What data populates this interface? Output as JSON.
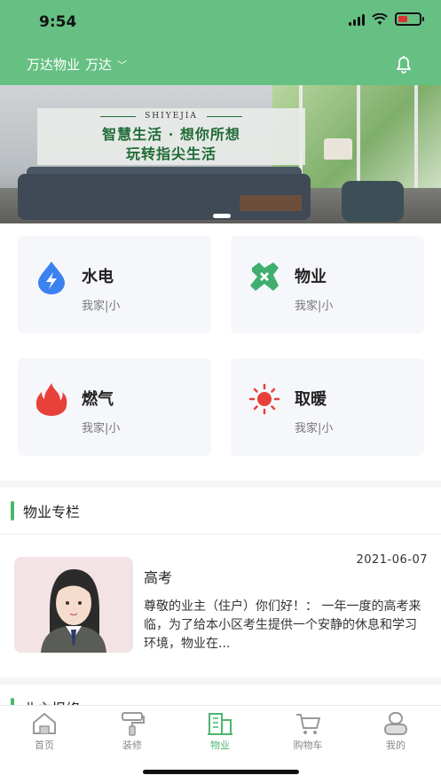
{
  "status_bar": {
    "time": "9:54"
  },
  "header": {
    "title": "万达物业",
    "community": "万达",
    "community_chevron": "﹀"
  },
  "banner": {
    "brand": "SHIYEJIA",
    "slogan_line1": "智慧生活 · 想你所想",
    "slogan_line2": "玩转指尖生活"
  },
  "services": [
    {
      "name": "水电",
      "sub": "我家|小",
      "icon": "water-drop-lightning-icon",
      "color": "#3b82f0"
    },
    {
      "name": "物业",
      "sub": "我家|小",
      "icon": "tools-icon",
      "color": "#3fae6e"
    },
    {
      "name": "燃气",
      "sub": "我家|小",
      "icon": "flame-icon",
      "color": "#e8403a"
    },
    {
      "name": "取暖",
      "sub": "我家|小",
      "icon": "sun-icon",
      "color": "#e8403a"
    }
  ],
  "column": {
    "title": "物业专栏",
    "article": {
      "date": "2021-06-07",
      "title": "高考",
      "body": "尊敬的业主（住户）你们好！：  一年一度的高考来临，为了给本小区考生提供一个安静的休息和学习环境，物业在..."
    }
  },
  "next_section": {
    "title": "业主报修"
  },
  "tabbar": [
    {
      "label": "首页",
      "icon": "home-icon"
    },
    {
      "label": "装修",
      "icon": "paint-roller-icon"
    },
    {
      "label": "物业",
      "icon": "building-icon",
      "active": true
    },
    {
      "label": "购物车",
      "icon": "cart-icon"
    },
    {
      "label": "我的",
      "icon": "user-icon"
    }
  ],
  "colors": {
    "accent": "#66c083",
    "active": "#4cb66d"
  }
}
